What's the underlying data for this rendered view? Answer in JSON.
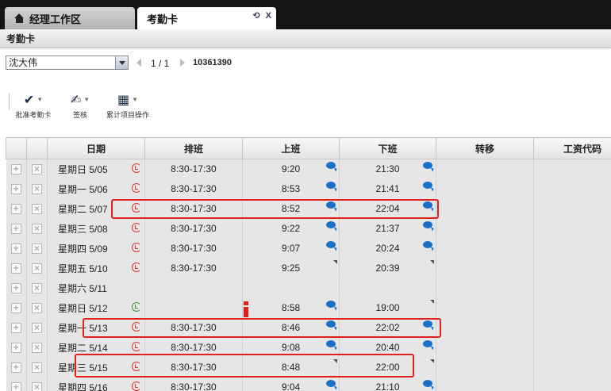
{
  "tabs": [
    {
      "label": "经理工作区",
      "icon": "home-icon"
    },
    {
      "label": "考勤卡",
      "icon": "refresh-icon",
      "close": "X"
    }
  ],
  "title": "考勤卡",
  "employee": {
    "selected": "沈大伟",
    "id": "10361390"
  },
  "pager": {
    "text": "1 / 1"
  },
  "toolbar": {
    "approve": "批准考勤卡",
    "sign": "签核",
    "accum": "累计项目操作"
  },
  "columns": [
    "日期",
    "排班",
    "上班",
    "下班",
    "转移",
    "工资代码"
  ],
  "rows": [
    {
      "date": "星期日 5/05",
      "icon": "red",
      "shift": "8:30-17:30",
      "in": "9:20",
      "in_mark": "comment",
      "out": "21:30",
      "out_mark": "comment"
    },
    {
      "date": "星期一 5/06",
      "icon": "red",
      "shift": "8:30-17:30",
      "in": "8:53",
      "in_mark": "comment",
      "out": "21:41",
      "out_mark": "comment"
    },
    {
      "date": "星期二 5/07",
      "icon": "red",
      "shift": "8:30-17:30",
      "in": "8:52",
      "in_mark": "comment",
      "out": "22:04",
      "out_mark": "comment"
    },
    {
      "date": "星期三 5/08",
      "icon": "red",
      "shift": "8:30-17:30",
      "in": "9:22",
      "in_mark": "comment",
      "out": "21:37",
      "out_mark": "comment"
    },
    {
      "date": "星期四 5/09",
      "icon": "red",
      "shift": "8:30-17:30",
      "in": "9:07",
      "in_mark": "comment",
      "out": "20:24",
      "out_mark": "comment"
    },
    {
      "date": "星期五 5/10",
      "icon": "red",
      "shift": "8:30-17:30",
      "in": "9:25",
      "in_mark": "tri",
      "out": "20:39",
      "out_mark": "tri"
    },
    {
      "date": "星期六 5/11",
      "icon": "",
      "shift": "",
      "in": "",
      "in_mark": "",
      "out": "",
      "out_mark": ""
    },
    {
      "date": "星期日 5/12",
      "icon": "green",
      "shift": "",
      "in": "8:58",
      "in_mark": "comment",
      "out": "19:00",
      "out_mark": "tri"
    },
    {
      "date": "星期一 5/13",
      "icon": "red",
      "shift": "8:30-17:30",
      "in": "8:46",
      "in_mark": "comment",
      "out": "22:02",
      "out_mark": "comment"
    },
    {
      "date": "星期二 5/14",
      "icon": "red",
      "shift": "8:30-17:30",
      "in": "9:08",
      "in_mark": "comment",
      "out": "20:40",
      "out_mark": "comment"
    },
    {
      "date": "星期三 5/15",
      "icon": "red",
      "shift": "8:30-17:30",
      "in": "8:48",
      "in_mark": "tri",
      "out": "22:00",
      "out_mark": "tri"
    },
    {
      "date": "星期四 5/16",
      "icon": "red",
      "shift": "8:30-17:30",
      "in": "9:04",
      "in_mark": "comment",
      "out": "21:10",
      "out_mark": "comment"
    }
  ]
}
